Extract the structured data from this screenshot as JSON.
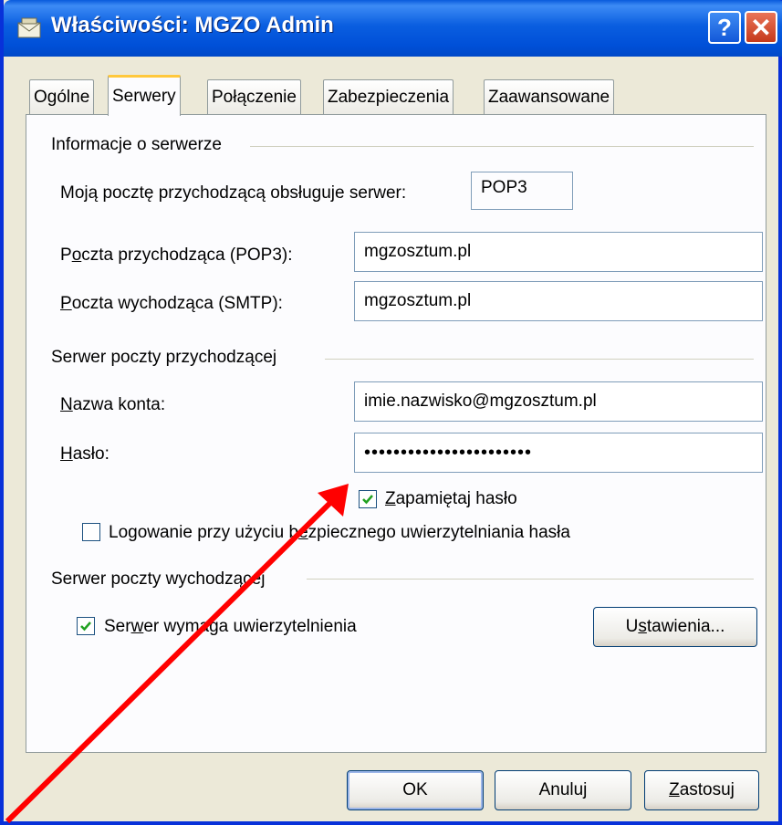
{
  "window": {
    "title": "Właściwości: MGZO Admin",
    "help": "?",
    "close": "✕"
  },
  "tabs": [
    "Ogólne",
    "Serwery",
    "Połączenie",
    "Zabezpieczenia",
    "Zaawansowane"
  ],
  "server_info": {
    "group_title": "Informacje o serwerze",
    "incoming_type_label": "Moją pocztę przychodzącą obsługuje serwer:",
    "incoming_type_value": "POP3",
    "incoming_label": "Poczta przychodząca (POP3):",
    "incoming_value": "mgzosztum.pl",
    "outgoing_label": "Poczta wychodząca (SMTP):",
    "outgoing_value": "mgzosztum.pl"
  },
  "incoming_server": {
    "group_title": "Serwer poczty przychodzącej",
    "account_label": "Nazwa konta:",
    "account_value": "imie.nazwisko@mgzosztum.pl",
    "password_label": "Hasło:",
    "password_value": "•••••••••••••••••••••••",
    "remember_label": "Zapamiętaj hasło",
    "remember_checked": true,
    "spa_label": "Logowanie przy użyciu bezpiecznego uwierzytelniania hasła",
    "spa_checked": false
  },
  "outgoing_server": {
    "group_title": "Serwer poczty wychodzącej",
    "auth_label": "Serwer wymaga uwierzytelnienia",
    "auth_checked": true,
    "settings_button": "Ustawienia..."
  },
  "buttons": {
    "ok": "OK",
    "cancel": "Anuluj",
    "apply": "Zastosuj"
  },
  "colors": {
    "title_bar": "#0a5ee0",
    "annotation_arrow": "#ff0000",
    "check": "#21a121"
  }
}
